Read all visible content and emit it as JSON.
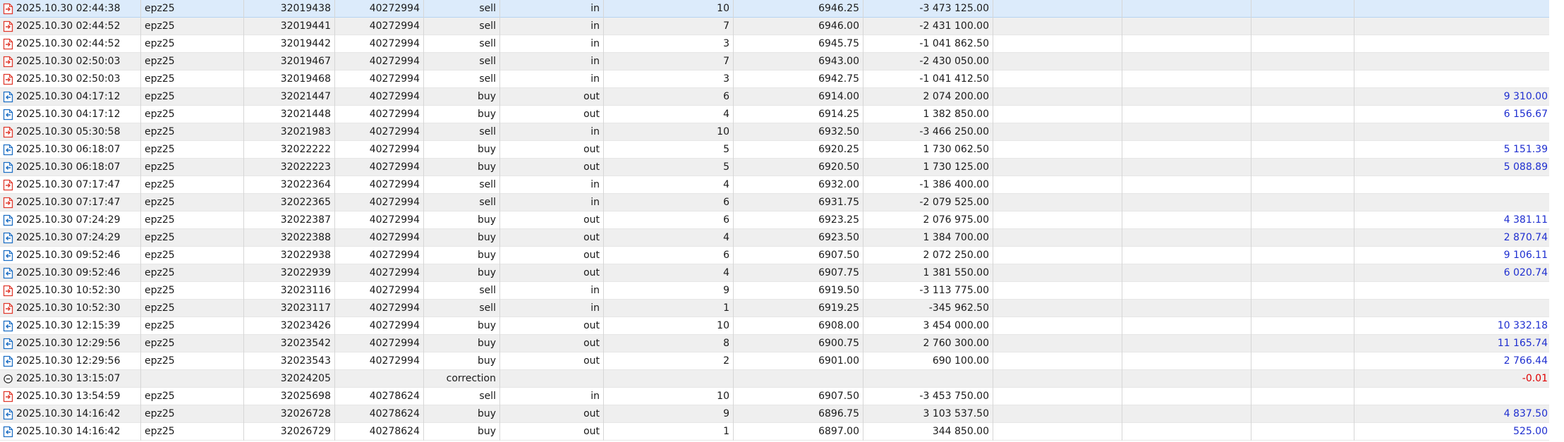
{
  "colors": {
    "sell_icon": "#e03a2e",
    "buy_icon": "#1e6fc4",
    "profit_positive": "#1f2fd0",
    "profit_negative": "#e00000",
    "row_alt": "#efefef",
    "row_selected": "#dcebfb"
  },
  "rows": [
    {
      "icon": "sell-icon",
      "time": "2025.10.30 02:44:38",
      "symbol": "epz25",
      "deal": "32019438",
      "order": "40272994",
      "type": "sell",
      "direction": "in",
      "volume": "10",
      "price": "6946.25",
      "amount": "-3 473 125.00",
      "profit": ""
    },
    {
      "icon": "sell-icon",
      "time": "2025.10.30 02:44:52",
      "symbol": "epz25",
      "deal": "32019441",
      "order": "40272994",
      "type": "sell",
      "direction": "in",
      "volume": "7",
      "price": "6946.00",
      "amount": "-2 431 100.00",
      "profit": ""
    },
    {
      "icon": "sell-icon",
      "time": "2025.10.30 02:44:52",
      "symbol": "epz25",
      "deal": "32019442",
      "order": "40272994",
      "type": "sell",
      "direction": "in",
      "volume": "3",
      "price": "6945.75",
      "amount": "-1 041 862.50",
      "profit": ""
    },
    {
      "icon": "sell-icon",
      "time": "2025.10.30 02:50:03",
      "symbol": "epz25",
      "deal": "32019467",
      "order": "40272994",
      "type": "sell",
      "direction": "in",
      "volume": "7",
      "price": "6943.00",
      "amount": "-2 430 050.00",
      "profit": ""
    },
    {
      "icon": "sell-icon",
      "time": "2025.10.30 02:50:03",
      "symbol": "epz25",
      "deal": "32019468",
      "order": "40272994",
      "type": "sell",
      "direction": "in",
      "volume": "3",
      "price": "6942.75",
      "amount": "-1 041 412.50",
      "profit": ""
    },
    {
      "icon": "buy-icon",
      "time": "2025.10.30 04:17:12",
      "symbol": "epz25",
      "deal": "32021447",
      "order": "40272994",
      "type": "buy",
      "direction": "out",
      "volume": "6",
      "price": "6914.00",
      "amount": "2 074 200.00",
      "profit": "9 310.00"
    },
    {
      "icon": "buy-icon",
      "time": "2025.10.30 04:17:12",
      "symbol": "epz25",
      "deal": "32021448",
      "order": "40272994",
      "type": "buy",
      "direction": "out",
      "volume": "4",
      "price": "6914.25",
      "amount": "1 382 850.00",
      "profit": "6 156.67"
    },
    {
      "icon": "sell-icon",
      "time": "2025.10.30 05:30:58",
      "symbol": "epz25",
      "deal": "32021983",
      "order": "40272994",
      "type": "sell",
      "direction": "in",
      "volume": "10",
      "price": "6932.50",
      "amount": "-3 466 250.00",
      "profit": ""
    },
    {
      "icon": "buy-icon",
      "time": "2025.10.30 06:18:07",
      "symbol": "epz25",
      "deal": "32022222",
      "order": "40272994",
      "type": "buy",
      "direction": "out",
      "volume": "5",
      "price": "6920.25",
      "amount": "1 730 062.50",
      "profit": "5 151.39"
    },
    {
      "icon": "buy-icon",
      "time": "2025.10.30 06:18:07",
      "symbol": "epz25",
      "deal": "32022223",
      "order": "40272994",
      "type": "buy",
      "direction": "out",
      "volume": "5",
      "price": "6920.50",
      "amount": "1 730 125.00",
      "profit": "5 088.89"
    },
    {
      "icon": "sell-icon",
      "time": "2025.10.30 07:17:47",
      "symbol": "epz25",
      "deal": "32022364",
      "order": "40272994",
      "type": "sell",
      "direction": "in",
      "volume": "4",
      "price": "6932.00",
      "amount": "-1 386 400.00",
      "profit": ""
    },
    {
      "icon": "sell-icon",
      "time": "2025.10.30 07:17:47",
      "symbol": "epz25",
      "deal": "32022365",
      "order": "40272994",
      "type": "sell",
      "direction": "in",
      "volume": "6",
      "price": "6931.75",
      "amount": "-2 079 525.00",
      "profit": ""
    },
    {
      "icon": "buy-icon",
      "time": "2025.10.30 07:24:29",
      "symbol": "epz25",
      "deal": "32022387",
      "order": "40272994",
      "type": "buy",
      "direction": "out",
      "volume": "6",
      "price": "6923.25",
      "amount": "2 076 975.00",
      "profit": "4 381.11"
    },
    {
      "icon": "buy-icon",
      "time": "2025.10.30 07:24:29",
      "symbol": "epz25",
      "deal": "32022388",
      "order": "40272994",
      "type": "buy",
      "direction": "out",
      "volume": "4",
      "price": "6923.50",
      "amount": "1 384 700.00",
      "profit": "2 870.74"
    },
    {
      "icon": "buy-icon",
      "time": "2025.10.30 09:52:46",
      "symbol": "epz25",
      "deal": "32022938",
      "order": "40272994",
      "type": "buy",
      "direction": "out",
      "volume": "6",
      "price": "6907.50",
      "amount": "2 072 250.00",
      "profit": "9 106.11"
    },
    {
      "icon": "buy-icon",
      "time": "2025.10.30 09:52:46",
      "symbol": "epz25",
      "deal": "32022939",
      "order": "40272994",
      "type": "buy",
      "direction": "out",
      "volume": "4",
      "price": "6907.75",
      "amount": "1 381 550.00",
      "profit": "6 020.74"
    },
    {
      "icon": "sell-icon",
      "time": "2025.10.30 10:52:30",
      "symbol": "epz25",
      "deal": "32023116",
      "order": "40272994",
      "type": "sell",
      "direction": "in",
      "volume": "9",
      "price": "6919.50",
      "amount": "-3 113 775.00",
      "profit": ""
    },
    {
      "icon": "sell-icon",
      "time": "2025.10.30 10:52:30",
      "symbol": "epz25",
      "deal": "32023117",
      "order": "40272994",
      "type": "sell",
      "direction": "in",
      "volume": "1",
      "price": "6919.25",
      "amount": "-345 962.50",
      "profit": ""
    },
    {
      "icon": "buy-icon",
      "time": "2025.10.30 12:15:39",
      "symbol": "epz25",
      "deal": "32023426",
      "order": "40272994",
      "type": "buy",
      "direction": "out",
      "volume": "10",
      "price": "6908.00",
      "amount": "3 454 000.00",
      "profit": "10 332.18"
    },
    {
      "icon": "buy-icon",
      "time": "2025.10.30 12:29:56",
      "symbol": "epz25",
      "deal": "32023542",
      "order": "40272994",
      "type": "buy",
      "direction": "out",
      "volume": "8",
      "price": "6900.75",
      "amount": "2 760 300.00",
      "profit": "11 165.74"
    },
    {
      "icon": "buy-icon",
      "time": "2025.10.30 12:29:56",
      "symbol": "epz25",
      "deal": "32023543",
      "order": "40272994",
      "type": "buy",
      "direction": "out",
      "volume": "2",
      "price": "6901.00",
      "amount": "690 100.00",
      "profit": "2 766.44"
    },
    {
      "icon": "correction-icon",
      "time": "2025.10.30 13:15:07",
      "symbol": "",
      "deal": "32024205",
      "order": "",
      "type": "correction",
      "direction": "",
      "volume": "",
      "price": "",
      "amount": "",
      "profit": "-0.01"
    },
    {
      "icon": "sell-icon",
      "time": "2025.10.30 13:54:59",
      "symbol": "epz25",
      "deal": "32025698",
      "order": "40278624",
      "type": "sell",
      "direction": "in",
      "volume": "10",
      "price": "6907.50",
      "amount": "-3 453 750.00",
      "profit": ""
    },
    {
      "icon": "buy-icon",
      "time": "2025.10.30 14:16:42",
      "symbol": "epz25",
      "deal": "32026728",
      "order": "40278624",
      "type": "buy",
      "direction": "out",
      "volume": "9",
      "price": "6896.75",
      "amount": "3 103 537.50",
      "profit": "4 837.50"
    },
    {
      "icon": "buy-icon",
      "time": "2025.10.30 14:16:42",
      "symbol": "epz25",
      "deal": "32026729",
      "order": "40278624",
      "type": "buy",
      "direction": "out",
      "volume": "1",
      "price": "6897.00",
      "amount": "344 850.00",
      "profit": "525.00"
    }
  ]
}
